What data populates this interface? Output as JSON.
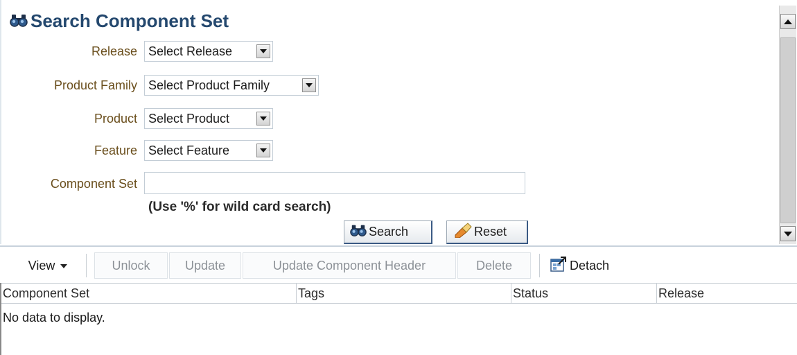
{
  "panel": {
    "title": "Search Component Set",
    "fields": {
      "release": {
        "label": "Release",
        "value": "Select Release"
      },
      "product_family": {
        "label": "Product Family",
        "value": "Select Product Family"
      },
      "product": {
        "label": "Product",
        "value": "Select Product"
      },
      "feature": {
        "label": "Feature",
        "value": "Select Feature"
      },
      "component_set": {
        "label": "Component Set",
        "value": "",
        "placeholder": ""
      }
    },
    "hint": "(Use '%' for wild card search)",
    "search_label": "Search",
    "reset_label": "Reset"
  },
  "toolbar": {
    "view_label": "View",
    "unlock_label": "Unlock",
    "update_label": "Update",
    "update_header_label": "Update Component Header",
    "delete_label": "Delete",
    "detach_label": "Detach"
  },
  "table": {
    "columns": [
      "Component Set",
      "Tags",
      "Status",
      "Release"
    ],
    "empty_message": "No data to display."
  },
  "colors": {
    "title": "#24486e",
    "label": "#6a4e1c",
    "disabled_text": "#8c9197"
  },
  "icons": {
    "title": "binoculars-icon",
    "search": "binoculars-icon",
    "reset": "eraser-icon",
    "detach": "detach-window-icon",
    "view": "caret-down-icon",
    "dropdown": "triangle-down-icon"
  }
}
